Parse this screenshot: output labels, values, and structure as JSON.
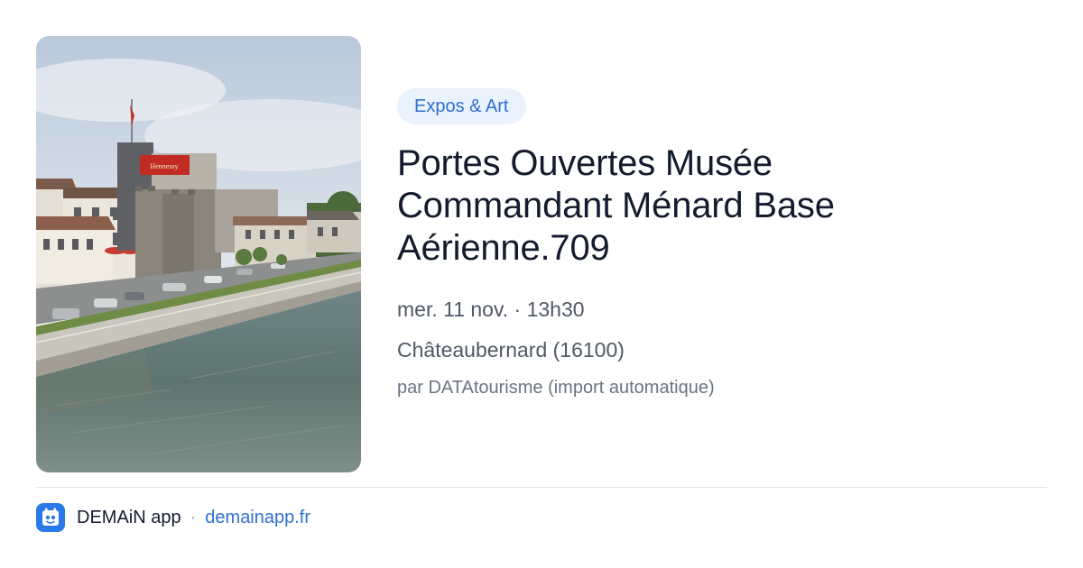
{
  "event": {
    "category": "Expos & Art",
    "title": "Portes Ouvertes Musée Commandant Ménard Base Aérienne.709",
    "date": "mer. 11 nov. · 13h30",
    "location": "Châteaubernard (16100)",
    "source": "par DATAtourisme (import automatique)"
  },
  "photo": {
    "sign_text": "Hennessy",
    "icon": "riverside-town-photo"
  },
  "footer": {
    "app_name": "DEMAiN app",
    "separator": "·",
    "url": "demainapp.fr",
    "logo_icon": "demain-app-logo-icon"
  },
  "colors": {
    "accent": "#2f6fd1",
    "chip_bg": "#eaf2fd",
    "logo_bg": "#2a79e8",
    "title": "#141b2d",
    "muted": "#505866"
  }
}
